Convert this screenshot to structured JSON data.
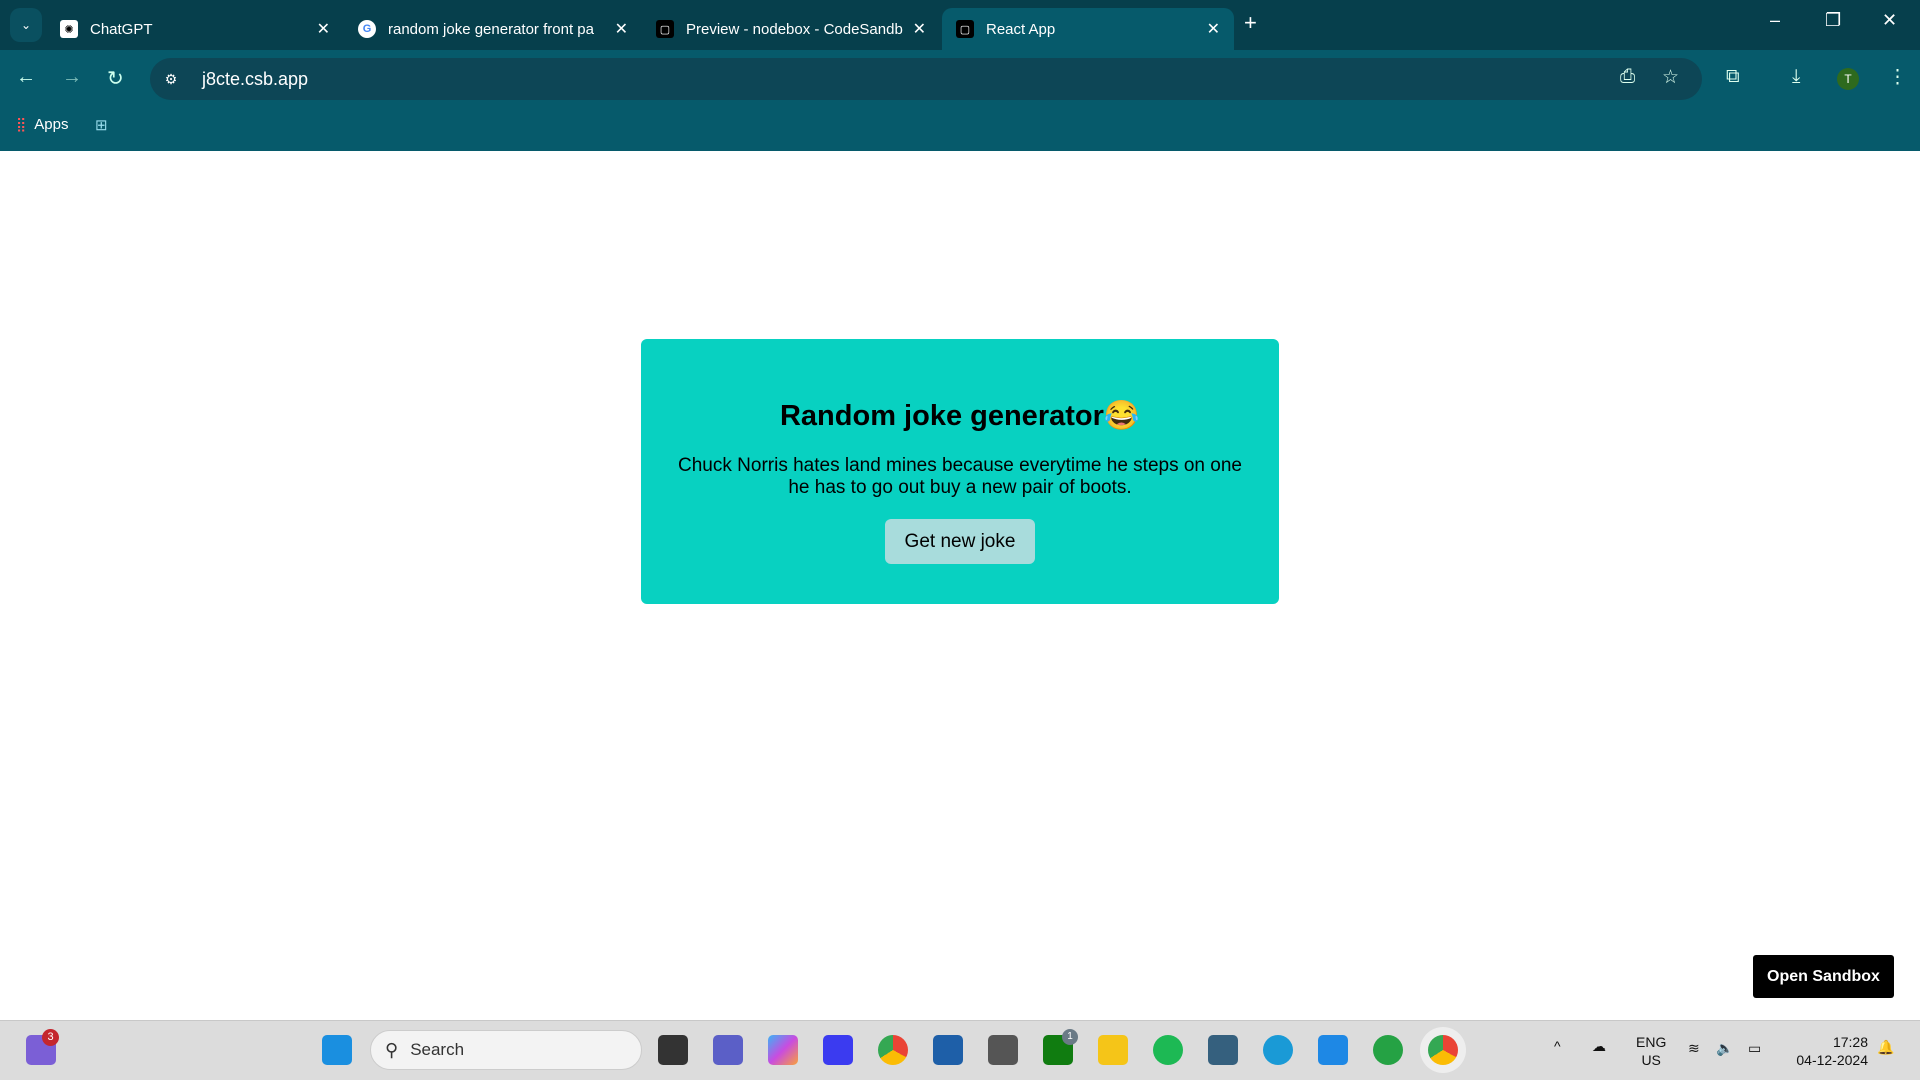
{
  "browser": {
    "tabs": [
      {
        "title": "ChatGPT"
      },
      {
        "title": "random joke generator front pa"
      },
      {
        "title": "Preview - nodebox - CodeSandb"
      },
      {
        "title": "React App"
      }
    ],
    "active_tab": 3,
    "url": "j8cte.csb.app",
    "bookmarks": {
      "apps_label": "Apps"
    },
    "profile_initial": "T"
  },
  "page": {
    "title": "Random joke generator😂",
    "joke": "Chuck Norris hates land mines because everytime he steps on one he has to go out buy a new pair of boots.",
    "button_label": "Get new joke",
    "open_sandbox_label": "Open Sandbox",
    "card_color": "#08d1c1"
  },
  "taskbar": {
    "search_placeholder": "Search",
    "teams_badge": "3",
    "xbox_badge": "1",
    "lang_top": "ENG",
    "lang_bottom": "US",
    "time": "17:28",
    "date": "04-12-2024"
  }
}
